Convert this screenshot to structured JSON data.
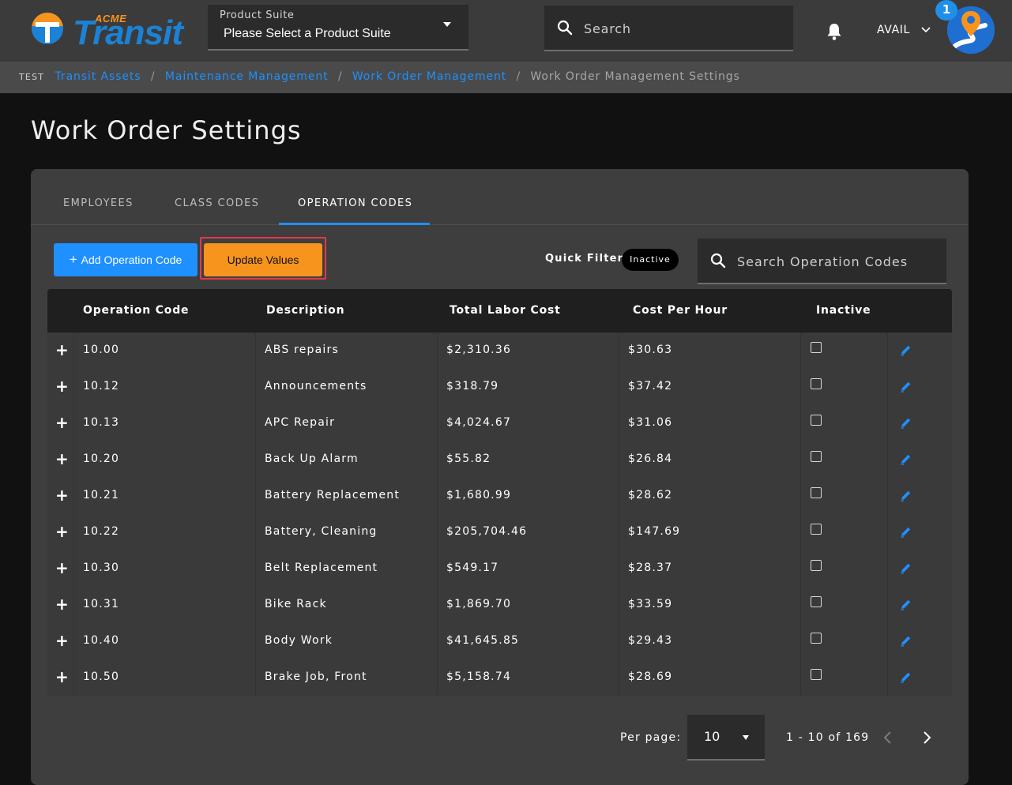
{
  "brand": {
    "acme": "ACME",
    "transit": "Transit"
  },
  "header": {
    "product_suite_label": "Product Suite",
    "product_suite_value": "Please Select a Product Suite",
    "search_placeholder": "Search",
    "user_name": "AVAIL",
    "notification_count": "1"
  },
  "breadcrumb": {
    "env_tag": "TEST",
    "links": [
      "Transit Assets",
      "Maintenance Management",
      "Work Order Management"
    ],
    "current": "Work Order Management Settings"
  },
  "page_title": "Work Order Settings",
  "tabs": [
    {
      "label": "EMPLOYEES",
      "active": false
    },
    {
      "label": "CLASS CODES",
      "active": false
    },
    {
      "label": "OPERATION CODES",
      "active": true
    }
  ],
  "toolbar": {
    "add_label": "Add Operation Code",
    "update_label": "Update Values",
    "quick_filter_label": "Quick Filter:",
    "quick_filter_chip": "Inactive",
    "search_placeholder": "Search Operation Codes"
  },
  "table": {
    "columns": [
      "Operation Code",
      "Description",
      "Total Labor Cost",
      "Cost Per Hour",
      "Inactive"
    ],
    "rows": [
      {
        "code": "10.00",
        "description": "ABS repairs",
        "total_labor_cost": "$2,310.36",
        "cost_per_hour": "$30.63",
        "inactive": false
      },
      {
        "code": "10.12",
        "description": "Announcements",
        "total_labor_cost": "$318.79",
        "cost_per_hour": "$37.42",
        "inactive": false
      },
      {
        "code": "10.13",
        "description": "APC Repair",
        "total_labor_cost": "$4,024.67",
        "cost_per_hour": "$31.06",
        "inactive": false
      },
      {
        "code": "10.20",
        "description": "Back Up Alarm",
        "total_labor_cost": "$55.82",
        "cost_per_hour": "$26.84",
        "inactive": false
      },
      {
        "code": "10.21",
        "description": "Battery Replacement",
        "total_labor_cost": "$1,680.99",
        "cost_per_hour": "$28.62",
        "inactive": false
      },
      {
        "code": "10.22",
        "description": "Battery, Cleaning",
        "total_labor_cost": "$205,704.46",
        "cost_per_hour": "$147.69",
        "inactive": false
      },
      {
        "code": "10.30",
        "description": "Belt Replacement",
        "total_labor_cost": "$549.17",
        "cost_per_hour": "$28.37",
        "inactive": false
      },
      {
        "code": "10.31",
        "description": "Bike Rack",
        "total_labor_cost": "$1,869.70",
        "cost_per_hour": "$33.59",
        "inactive": false
      },
      {
        "code": "10.40",
        "description": "Body Work",
        "total_labor_cost": "$41,645.85",
        "cost_per_hour": "$29.43",
        "inactive": false
      },
      {
        "code": "10.50",
        "description": "Brake Job, Front",
        "total_labor_cost": "$5,158.74",
        "cost_per_hour": "$28.69",
        "inactive": false
      }
    ]
  },
  "pagination": {
    "per_page_label": "Per page:",
    "per_page_value": "10",
    "range": "1 - 10 of 169"
  },
  "colors": {
    "accent_blue": "#1e90ff",
    "accent_orange": "#f7941d",
    "highlight_red": "#e23a4a",
    "background": "#111111",
    "card": "#3e3e3e"
  },
  "icons": [
    "search-icon",
    "bell-icon",
    "chevron-down-icon",
    "caret-down-icon",
    "plus-icon",
    "edit-pencil-icon",
    "chevron-left-icon",
    "chevron-right-icon",
    "map-pin-avatar-icon"
  ]
}
